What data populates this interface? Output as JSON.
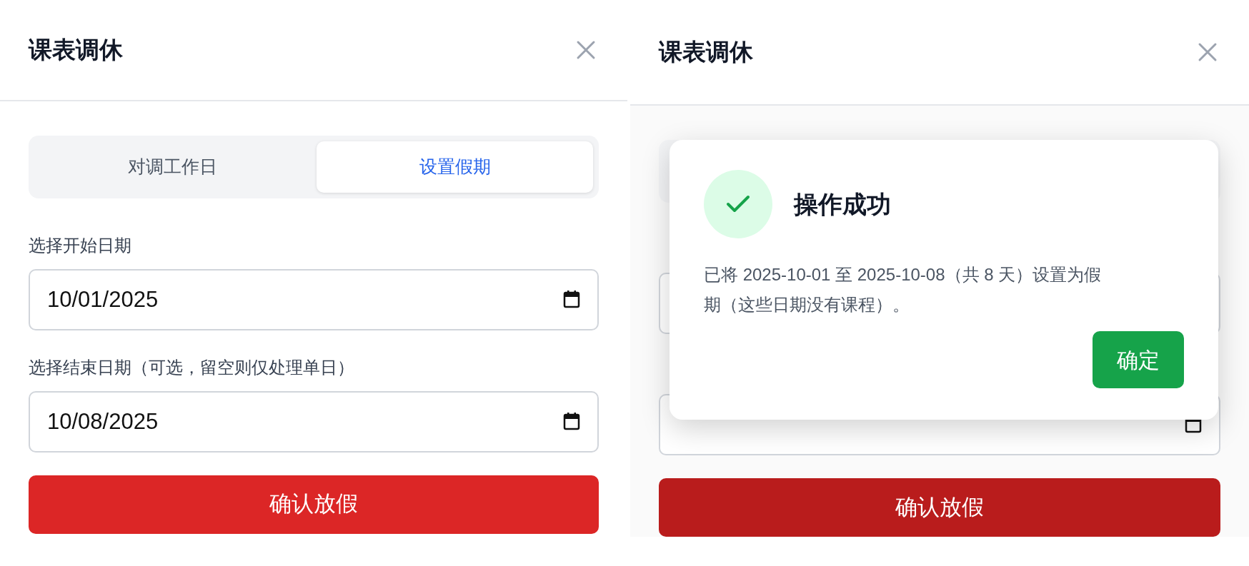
{
  "panels": [
    {
      "title": "课表调休",
      "dimmed": false,
      "tabs": [
        {
          "label": "对调工作日",
          "selected": false
        },
        {
          "label": "设置假期",
          "selected": true
        }
      ],
      "fields": [
        {
          "kind": "date",
          "label": "选择开始日期",
          "value": "10/01/2025"
        },
        {
          "kind": "date",
          "label": "选择结束日期（可选，留空则仅处理单日）",
          "value": "10/08/2025"
        }
      ],
      "submit": "确认放假"
    },
    {
      "title": "课表调休",
      "dimmed": true,
      "fields": [
        {
          "kind": "box"
        },
        {
          "kind": "date"
        }
      ],
      "submit": "确认放假",
      "dialog": {
        "title": "操作成功",
        "message": "已将 2025-10-01 至 2025-10-08（共 8 天）设置为假期（这些日期没有课程）。",
        "button": "确定"
      }
    }
  ]
}
